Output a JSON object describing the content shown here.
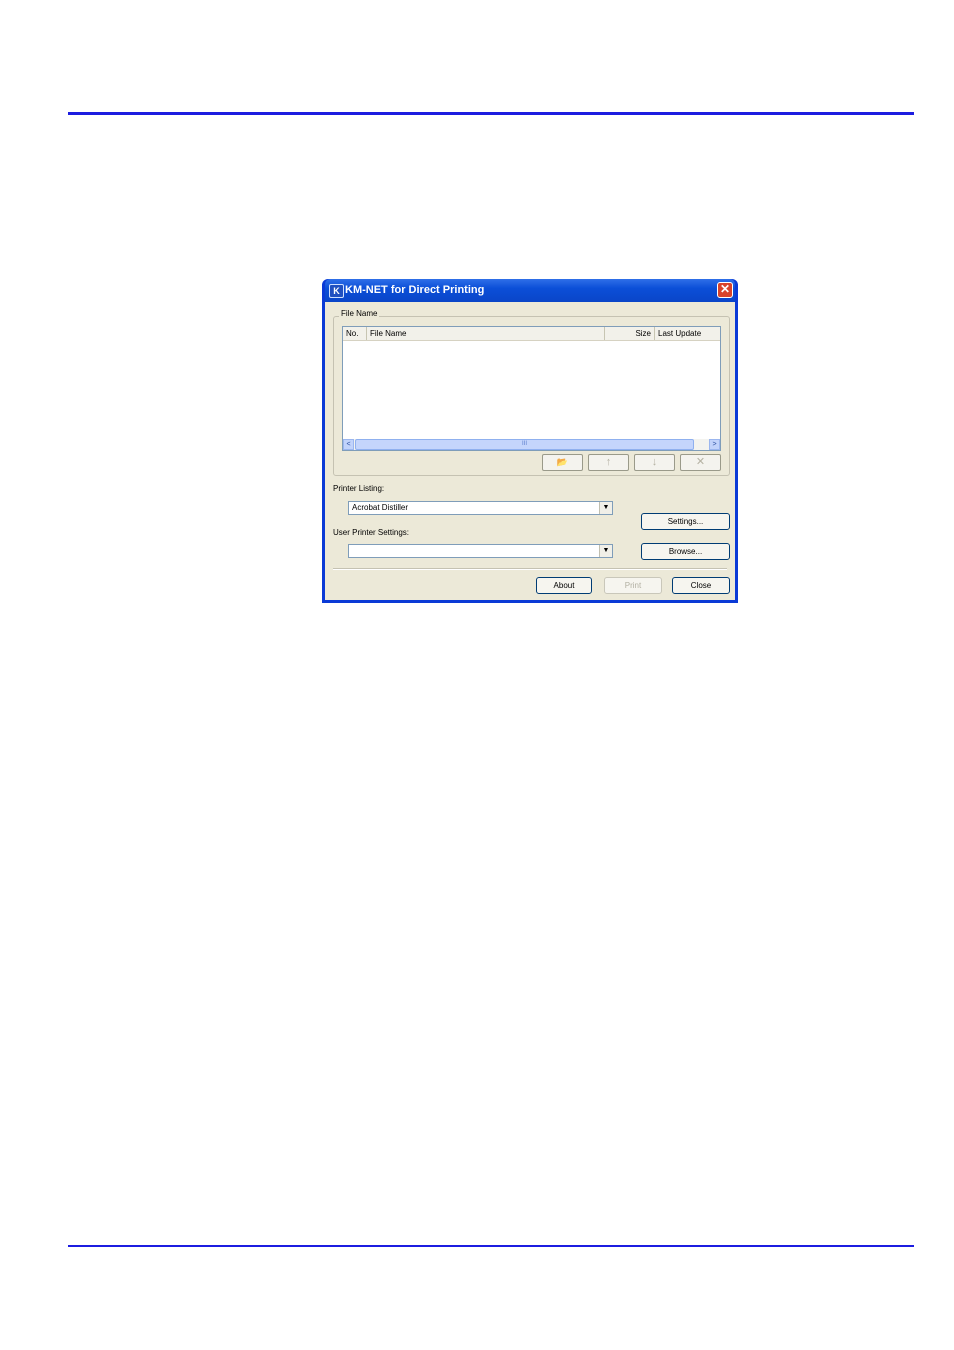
{
  "dialog": {
    "title": "KM-NET for Direct Printing",
    "close_glyph": "✕",
    "app_icon_glyph": "K"
  },
  "file_group": {
    "label": "File Name",
    "columns": [
      "No.",
      "File Name",
      "Size",
      "Last Update"
    ],
    "scroll_left_glyph": "<",
    "scroll_right_glyph": ">",
    "scroll_grip": "III",
    "toolbar": {
      "open_glyph": "📂",
      "up_glyph": "↑",
      "down_glyph": "↓",
      "delete_glyph": "✕"
    }
  },
  "printer_listing": {
    "label": "Printer Listing:",
    "value": "Acrobat Distiller",
    "arrow_glyph": "▼"
  },
  "user_settings": {
    "label": "User Printer Settings:",
    "value": "",
    "arrow_glyph": "▼"
  },
  "buttons": {
    "settings": "Settings...",
    "browse": "Browse...",
    "about": "About",
    "print": "Print",
    "close": "Close"
  },
  "icons": [
    "app-icon",
    "close-icon",
    "open-folder-icon",
    "arrow-up-icon",
    "arrow-down-icon",
    "delete-icon",
    "dropdown-arrow-icon"
  ],
  "colors": {
    "rule": "#1c1ce0",
    "titlebar": "#0b4fd8",
    "dialog_bg": "#ece9d8"
  }
}
